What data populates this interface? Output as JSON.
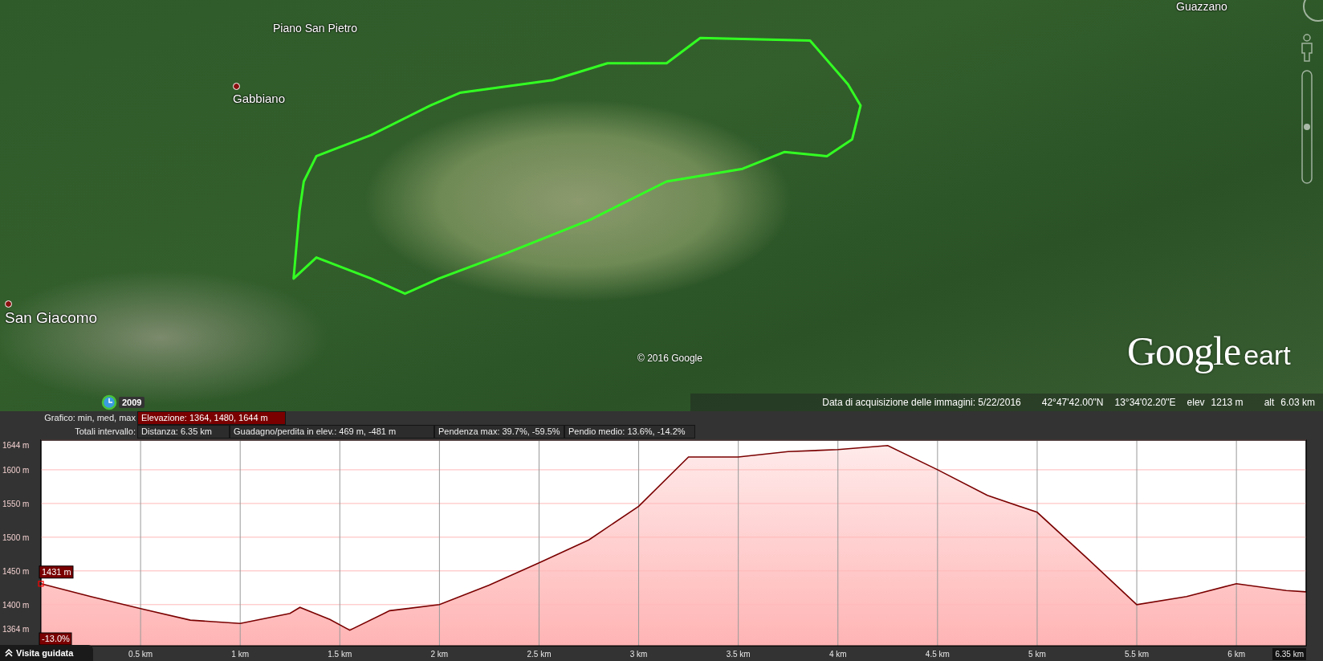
{
  "map": {
    "place_labels": [
      {
        "text": "Piano San Pietro",
        "kind": "plain"
      },
      {
        "text": "Gabbiano",
        "kind": "pin"
      },
      {
        "text": "San Giacomo",
        "kind": "pin-large"
      },
      {
        "text": "Guazzano",
        "kind": "plain"
      }
    ],
    "copyright": "© 2016 Google",
    "logo": {
      "word": "Google",
      "suffix": "eart"
    },
    "zoom_slider": {
      "level": 0.5
    },
    "historical_imagery": {
      "year": "2009"
    },
    "status_bar": {
      "imagery_date": "Data di acquisizione delle immagini: 5/22/2016",
      "latitude": "42°47'42.00\"N",
      "longitude": "13°34'02.20\"E",
      "elev_label": "elev",
      "elev_value": "1213 m",
      "alt_label": "alt",
      "alt_value": "6.03 km"
    }
  },
  "profile": {
    "graph_row": {
      "label": "Grafico: min, med, max",
      "options": [
        {
          "text": "Elevazione: 1364, 1480, 1644 m",
          "selected": true
        }
      ]
    },
    "totals_row": {
      "label": "Totali intervallo:",
      "items": [
        "Distanza: 6.35 km",
        "Guadagno/perdita in elev.: 469 m, -481 m",
        "Pendenza max: 39.7%, -59.5%",
        "Pendio medio: 13.6%, -14.2%"
      ]
    },
    "chart_data": {
      "type": "area",
      "xlim": [
        0,
        6.35
      ],
      "ylim": [
        1339,
        1644
      ],
      "x": [
        0,
        0.25,
        0.5,
        0.75,
        1,
        1.25,
        1.3,
        1.45,
        1.55,
        1.75,
        2,
        2.25,
        2.5,
        2.75,
        3,
        3.25,
        3.5,
        3.75,
        4,
        4.25,
        4.5,
        4.75,
        5,
        5.25,
        5.5,
        5.75,
        6,
        6.25,
        6.35
      ],
      "grid": true,
      "series": [
        {
          "color": "#7a0000",
          "values": [
            1431,
            1412,
            1394,
            1377,
            1372,
            1387,
            1396,
            1378,
            1362,
            1391,
            1400,
            1429,
            1462,
            1496,
            1546,
            1619,
            1619,
            1627,
            1630,
            1636,
            1600,
            1562,
            1537,
            1469,
            1400,
            1412,
            1431,
            1421,
            1419
          ]
        }
      ],
      "yticks": [
        {
          "value": 1364,
          "label": "1364 m"
        },
        {
          "value": 1400,
          "label": "1400 m"
        },
        {
          "value": 1450,
          "label": "1450 m"
        },
        {
          "value": 1500,
          "label": "1500 m"
        },
        {
          "value": 1550,
          "label": "1550 m"
        },
        {
          "value": 1600,
          "label": "1600 m"
        },
        {
          "value": 1644,
          "label": "1644 m"
        }
      ],
      "xticks": [
        {
          "value": 0.5,
          "label": "0.5 km"
        },
        {
          "value": 1,
          "label": "1 km"
        },
        {
          "value": 1.5,
          "label": "1.5 km"
        },
        {
          "value": 2,
          "label": "2 km"
        },
        {
          "value": 2.5,
          "label": "2.5 km"
        },
        {
          "value": 3,
          "label": "3 km"
        },
        {
          "value": 3.5,
          "label": "3.5 km"
        },
        {
          "value": 4,
          "label": "4 km"
        },
        {
          "value": 4.5,
          "label": "4.5 km"
        },
        {
          "value": 5,
          "label": "5 km"
        },
        {
          "value": 5.5,
          "label": "5.5 km"
        },
        {
          "value": 6,
          "label": "6 km"
        },
        {
          "value": 6.35,
          "label": "6.35 km"
        }
      ],
      "annotations": [
        {
          "x": 0,
          "y": 1431,
          "text": "1431 m"
        },
        {
          "x": 0,
          "text": "-13.0%"
        }
      ]
    }
  },
  "tour_button": {
    "label": "Visita guidata"
  }
}
